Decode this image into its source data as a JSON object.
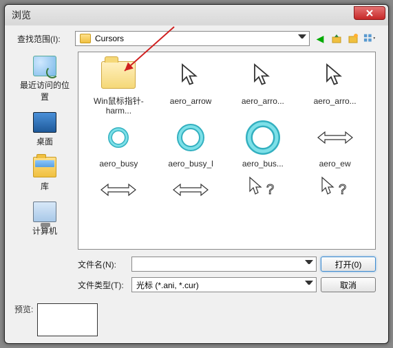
{
  "window": {
    "title": "浏览"
  },
  "lookin": {
    "label": "查找范围(I):",
    "value": "Cursors"
  },
  "toolbar": {
    "back": "back-icon",
    "up": "up-icon",
    "newfolder": "newfolder-icon",
    "views": "views-icon"
  },
  "sidebar": {
    "items": [
      {
        "label": "最近访问的位置"
      },
      {
        "label": "桌面"
      },
      {
        "label": "库"
      },
      {
        "label": "计算机"
      }
    ]
  },
  "files": [
    {
      "label": "Win鼠标指针-harm...",
      "kind": "folder"
    },
    {
      "label": "aero_arrow",
      "kind": "arrow"
    },
    {
      "label": "aero_arro...",
      "kind": "arrow"
    },
    {
      "label": "aero_arro...",
      "kind": "arrow"
    },
    {
      "label": "aero_busy",
      "kind": "busy_s"
    },
    {
      "label": "aero_busy_l",
      "kind": "busy_m"
    },
    {
      "label": "aero_bus...",
      "kind": "busy_l"
    },
    {
      "label": "aero_ew",
      "kind": "ew"
    },
    {
      "label": "",
      "kind": "ew"
    },
    {
      "label": "",
      "kind": "ew"
    },
    {
      "label": "",
      "kind": "help"
    },
    {
      "label": "",
      "kind": "help"
    }
  ],
  "filename": {
    "label": "文件名(N):",
    "value": ""
  },
  "filetype": {
    "label": "文件类型(T):",
    "value": "光标 (*.ani, *.cur)"
  },
  "buttons": {
    "open": "打开(0)",
    "cancel": "取消"
  },
  "preview": {
    "label": "预览:"
  },
  "colors": {
    "accent": "#3a8ad0",
    "busy": "#33b0c0"
  }
}
